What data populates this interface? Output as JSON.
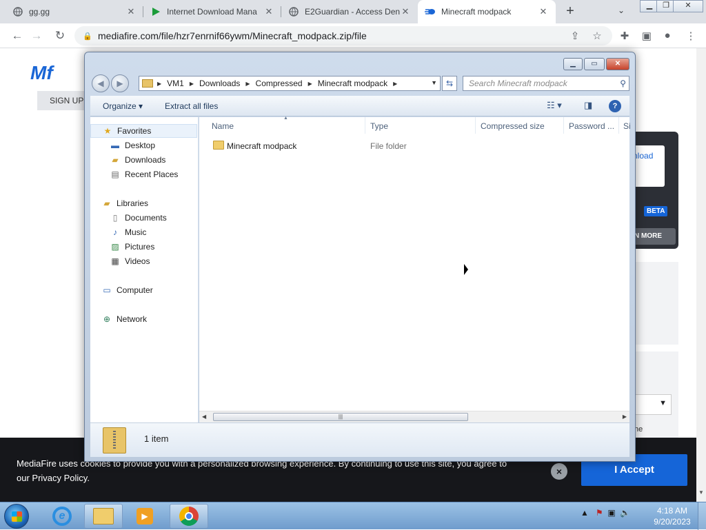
{
  "browser": {
    "tabs": [
      {
        "title": "gg.gg",
        "active": false,
        "icon": "globe-icon"
      },
      {
        "title": "Internet Download Mana",
        "active": false,
        "icon": "play-icon"
      },
      {
        "title": "E2Guardian - Access Den",
        "active": false,
        "icon": "globe-icon"
      },
      {
        "title": "Minecraft modpack",
        "active": true,
        "icon": "mediafire-icon"
      }
    ],
    "new_tab": "+",
    "tab_search": "⌄",
    "url": "mediafire.com/file/hzr7enrnif66ywm/Minecraft_modpack.zip/file"
  },
  "mediafire": {
    "logo": "Mf",
    "signup": "SIGN UP",
    "download_fragment": "nload",
    "beta": "BETA",
    "more_fragment": "N MORE",
    "the_fragment": "he",
    "cookie_text": "MediaFire uses cookies to provide you with a personalized browsing experience. By continuing to use this site, you agree to our Privacy Policy.",
    "cookie_close": "×",
    "accept": "I Accept"
  },
  "explorer": {
    "breadcrumb": [
      "VM1",
      "Downloads",
      "Compressed",
      "Minecraft modpack"
    ],
    "search_placeholder": "Search Minecraft modpack",
    "commands": {
      "organize": "Organize",
      "extract": "Extract all files"
    },
    "nav": {
      "favorites": "Favorites",
      "desktop": "Desktop",
      "downloads": "Downloads",
      "recent": "Recent Places",
      "libraries": "Libraries",
      "documents": "Documents",
      "music": "Music",
      "pictures": "Pictures",
      "videos": "Videos",
      "computer": "Computer",
      "network": "Network"
    },
    "columns": {
      "name": "Name",
      "type": "Type",
      "compressed": "Compressed size",
      "password": "Password ...",
      "size": "Si"
    },
    "files": [
      {
        "name": "Minecraft modpack",
        "type": "File folder"
      }
    ],
    "item_count": "1 item"
  },
  "taskbar": {
    "time": "4:18 AM",
    "date": "9/20/2023"
  }
}
